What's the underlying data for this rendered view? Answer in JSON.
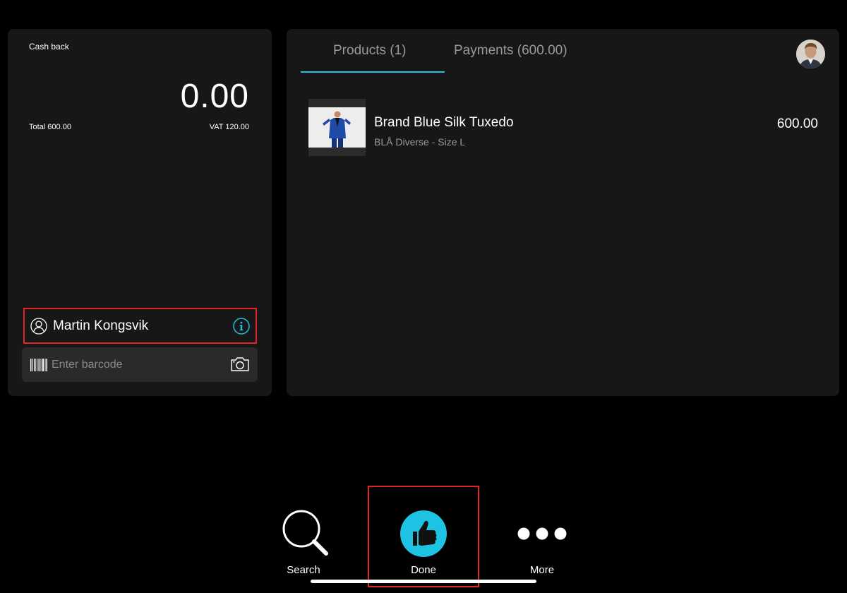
{
  "cash_panel": {
    "cash_back_label": "Cash back",
    "amount": "0.00",
    "total": "Total 600.00",
    "vat": "VAT 120.00"
  },
  "customer": {
    "name": "Martin Kongsvik",
    "icon": "user-icon",
    "info_icon": "info-icon"
  },
  "barcode": {
    "placeholder": "Enter barcode",
    "value": "",
    "icon": "barcode-icon",
    "camera_icon": "camera-icon"
  },
  "tabs": [
    {
      "label": "Products (1)",
      "active": true
    },
    {
      "label": "Payments (600.00)",
      "active": false
    }
  ],
  "products": [
    {
      "name": "Brand Blue Silk Tuxedo",
      "variant": "BLÅ Diverse - Size L",
      "price": "600.00"
    }
  ],
  "bottom_bar": {
    "search_label": "Search",
    "done_label": "Done",
    "more_label": "More"
  },
  "colors": {
    "accent": "#1ec3e4",
    "highlight": "#e0262b",
    "panel": "#171717",
    "background": "#000000"
  }
}
